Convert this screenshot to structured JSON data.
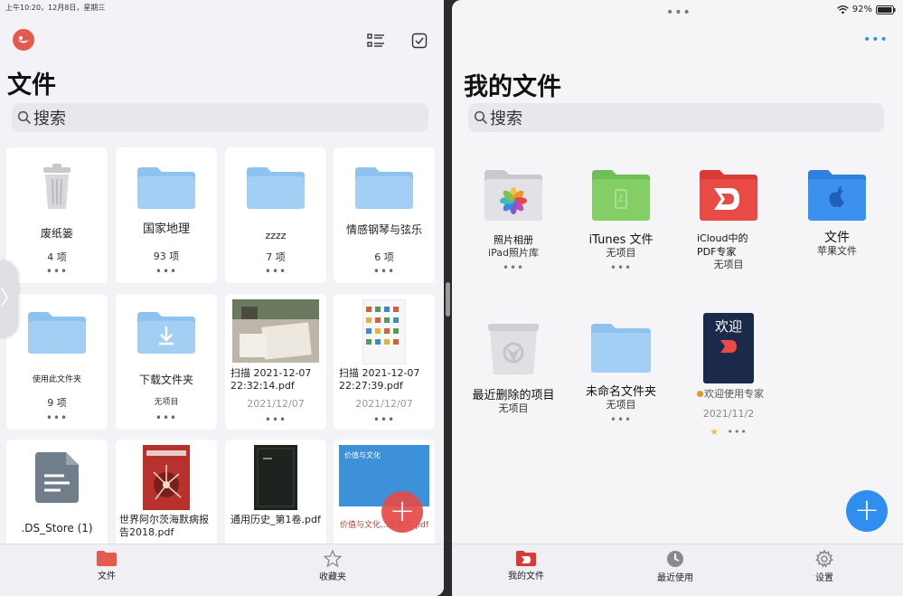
{
  "status_bar": {
    "time_date": "上午10:20，12月8日，星期三",
    "battery": "92%"
  },
  "left": {
    "title": "文件",
    "search_placeholder": "搜索",
    "tiles": [
      {
        "name": "废纸篓",
        "meta": "4 项"
      },
      {
        "name": "国家地理",
        "meta": "93 项"
      },
      {
        "name": "zzzz",
        "meta": "7 项"
      },
      {
        "name": "情感钢琴与弦乐",
        "meta": "6 项"
      },
      {
        "name": "使用此文件夹",
        "meta": "9 项"
      },
      {
        "name": "下载文件夹",
        "meta": "无项目"
      },
      {
        "name": "扫描 2021-12-07 22:32:14.pdf",
        "date": "2021/12/07"
      },
      {
        "name": "扫描 2021-12-07 22:27:39.pdf",
        "date": "2021/12/07"
      },
      {
        "name": ".DS_Store (1)"
      },
      {
        "name": "世界阿尔茨海默病报告2018.pdf"
      },
      {
        "name": "通用历史_第1卷.pdf"
      },
      {
        "name": "价值与文化...转更高.pdf",
        "thumb_title": "价值与文化"
      }
    ],
    "tabs": [
      {
        "label": "文件"
      },
      {
        "label": "收藏夹"
      }
    ]
  },
  "right": {
    "title": "我的文件",
    "search_placeholder": "搜索",
    "items": [
      {
        "name": "照片相册",
        "sub": "iPad照片库"
      },
      {
        "name": "iTunes 文件",
        "sub": "无项目"
      },
      {
        "name": "iCloud中的PDF专家",
        "sub": "无项目"
      },
      {
        "name": "文件",
        "sub": "苹果文件"
      },
      {
        "name": "最近删除的项目",
        "sub": "无项目"
      },
      {
        "name": "未命名文件夹",
        "sub": "无项目"
      },
      {
        "name": "欢迎使用专家",
        "date": "2021/11/2",
        "thumb_title": "欢迎"
      }
    ],
    "tabs": [
      {
        "label": "我的文件"
      },
      {
        "label": "最近使用"
      },
      {
        "label": "设置"
      }
    ]
  },
  "colors": {
    "accent_blue": "#2f8ef0",
    "accent_red": "#e54b4b",
    "folder_blue": "#8ec2ef"
  }
}
